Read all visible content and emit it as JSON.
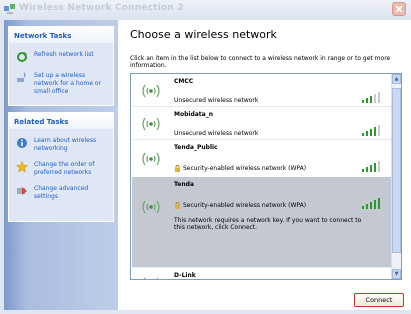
{
  "window": {
    "title": "Wireless Network Connection 2"
  },
  "network_tasks": {
    "heading": "Network Tasks",
    "items": [
      {
        "label": "Refresh network list",
        "icon": "refresh-icon"
      },
      {
        "label": "Set up a wireless network for a home or small office",
        "icon": "wireless-setup-icon"
      }
    ]
  },
  "related_tasks": {
    "heading": "Related Tasks",
    "items": [
      {
        "label": "Learn about wireless networking",
        "icon": "help-icon"
      },
      {
        "label": "Change the order of preferred networks",
        "icon": "star-icon"
      },
      {
        "label": "Change advanced settings",
        "icon": "settings-icon"
      }
    ]
  },
  "main": {
    "heading": "Choose a wireless network",
    "instructions": "Click an item in the list below to connect to a wireless network in range or to get more information.",
    "networks": [
      {
        "ssid": "CMCC",
        "security": "Unsecured wireless network",
        "signal": 3
      },
      {
        "ssid": "Mobidata_n",
        "security": "Unsecured wireless network",
        "signal": 4
      },
      {
        "ssid": "Tenda_Public",
        "security": "Security-enabled wireless network (WPA)",
        "signal": 4
      },
      {
        "ssid": "Tenda",
        "security": "Security-enabled wireless network (WPA)",
        "signal": 5,
        "selected": true,
        "message": "This network requires a network key. If you want to connect to this network, click Connect."
      },
      {
        "ssid": "D-Link",
        "security": "",
        "signal": 0
      }
    ],
    "connect_label": "Connect"
  },
  "colors": {
    "link": "#215dc6",
    "selection": "#c4c9d1",
    "signal": "#2e9a2e"
  }
}
